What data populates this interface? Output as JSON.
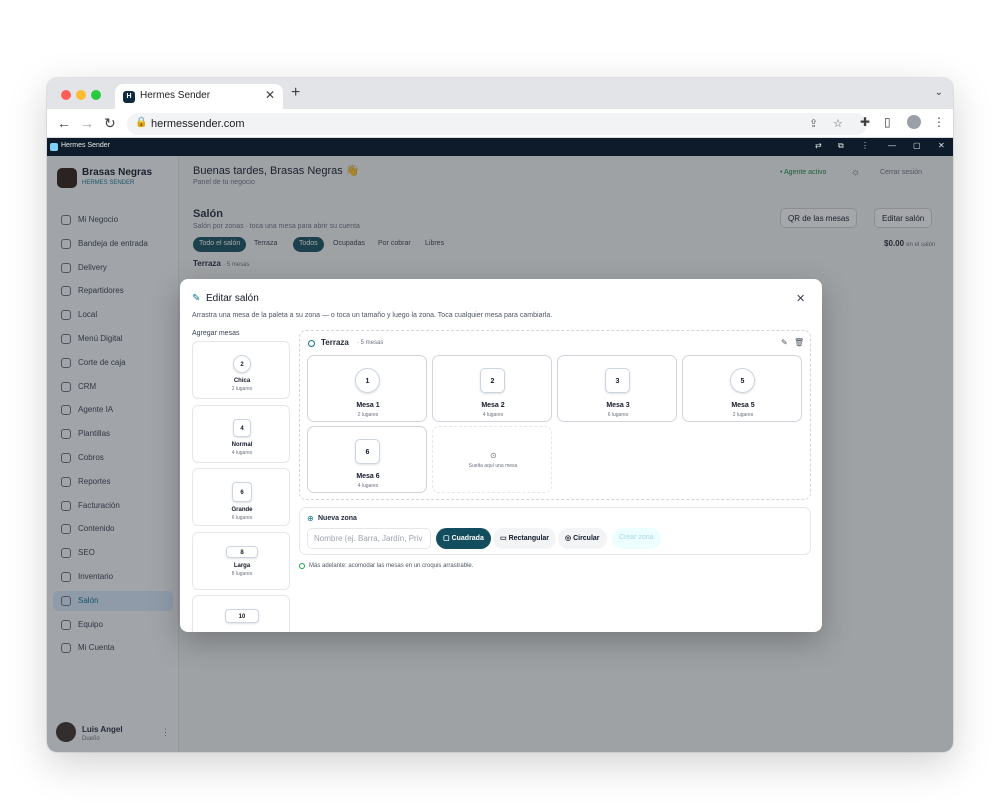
{
  "browser": {
    "tab_title": "Hermes Sender",
    "url": "hermessender.com",
    "app_name": "Hermes Sender"
  },
  "sidebar": {
    "business_name": "Brasas Negras",
    "business_tag": "HERMES SENDER",
    "items": [
      {
        "label": "Mi Negocio",
        "icon": "store-icon"
      },
      {
        "label": "Bandeja de entrada",
        "icon": "inbox-icon"
      },
      {
        "label": "Delivery",
        "icon": "delivery-icon"
      },
      {
        "label": "Repartidores",
        "icon": "riders-icon"
      },
      {
        "label": "Local",
        "icon": "local-icon"
      },
      {
        "label": "Menú Digital",
        "icon": "menu-icon"
      },
      {
        "label": "Corte de caja",
        "icon": "cash-icon"
      },
      {
        "label": "CRM",
        "icon": "crm-icon"
      },
      {
        "label": "Agente IA",
        "icon": "ai-icon"
      },
      {
        "label": "Plantillas",
        "icon": "template-icon"
      },
      {
        "label": "Cobros",
        "icon": "payments-icon"
      },
      {
        "label": "Reportes",
        "icon": "reports-icon"
      },
      {
        "label": "Facturación",
        "icon": "invoice-icon"
      },
      {
        "label": "Contenido",
        "icon": "content-icon"
      },
      {
        "label": "SEO",
        "icon": "seo-icon"
      },
      {
        "label": "Inventario",
        "icon": "inventory-icon"
      },
      {
        "label": "Salón",
        "icon": "floor-icon",
        "active": true
      },
      {
        "label": "Equipo",
        "icon": "team-icon"
      },
      {
        "label": "Mi Cuenta",
        "icon": "account-icon"
      }
    ],
    "user_name": "Luis Angel",
    "user_role": "Dueño"
  },
  "header": {
    "greeting": "Buenas tardes, Brasas Negras 👋",
    "subtitle": "Panel de tu negocio",
    "agent_status": "• Agente activo",
    "logout": "Cerrar sesión"
  },
  "page": {
    "title": "Salón",
    "subtitle": "Salón por zonas · toca una mesa para abrir su cuenta",
    "qr_button": "QR de las mesas",
    "edit_button": "Editar salón",
    "zone_filters": [
      "Todo el salón",
      "Terraza"
    ],
    "status_filters": [
      "Todos",
      "Ocupadas",
      "Por cobrar",
      "Libres"
    ],
    "total": "$0.00",
    "total_label": "en el salón",
    "zone_name": "Terraza",
    "zone_count": "· 5 mesas"
  },
  "modal": {
    "title": "Editar salón",
    "description": "Arrastra una mesa de la paleta a su zona — o toca un tamaño y luego la zona. Toca cualquier mesa para cambiarla.",
    "palette_title": "Agregar mesas",
    "palette": [
      {
        "seats_num": "2",
        "name": "Chica",
        "seats": "2 lugares"
      },
      {
        "seats_num": "4",
        "name": "Normal",
        "seats": "4 lugares"
      },
      {
        "seats_num": "6",
        "name": "Grande",
        "seats": "6 lugares"
      },
      {
        "seats_num": "8",
        "name": "Larga",
        "seats": "8 lugares"
      },
      {
        "seats_num": "10",
        "name": "",
        "seats": ""
      }
    ],
    "zone": {
      "name": "Terraza",
      "count": "· 5 mesas",
      "tables": [
        {
          "num": "1",
          "name": "Mesa 1",
          "seats": "2 lugares"
        },
        {
          "num": "2",
          "name": "Mesa 2",
          "seats": "4 lugares"
        },
        {
          "num": "3",
          "name": "Mesa 3",
          "seats": "6 lugares"
        },
        {
          "num": "5",
          "name": "Mesa 5",
          "seats": "2 lugares"
        },
        {
          "num": "6",
          "name": "Mesa 6",
          "seats": "4 lugares"
        }
      ],
      "drop_text": "Suelta aquí una mesa"
    },
    "new_zone": {
      "title": "Nueva zona",
      "placeholder": "Nombre (ej. Barra, Jardín, Priv",
      "shapes": [
        "Cuadrada",
        "Rectangular",
        "Circular"
      ],
      "selected_shape": "Cuadrada",
      "create_button": "Crear zona"
    },
    "note": "Más adelante: acomodar las mesas en un croquis arrastrable."
  }
}
